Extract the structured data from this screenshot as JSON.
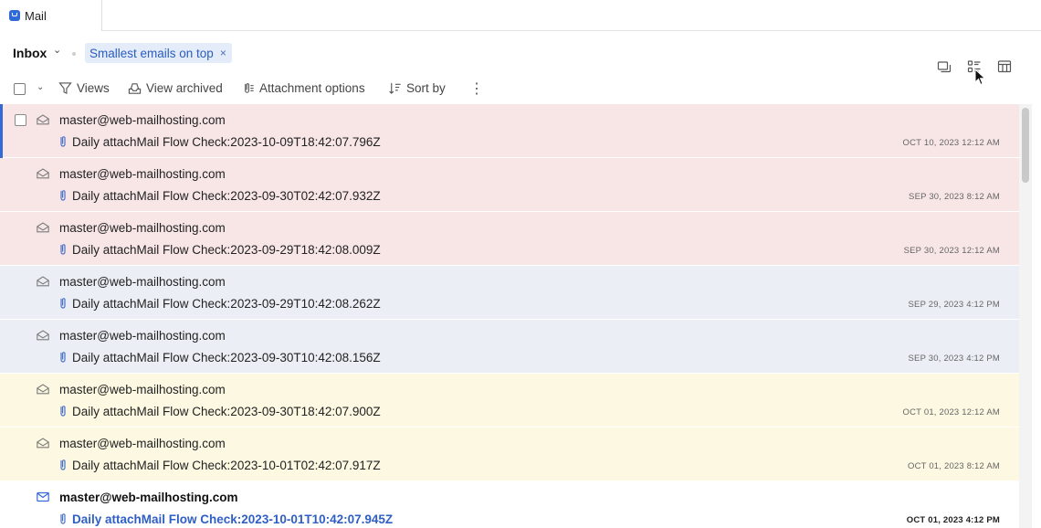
{
  "tab": {
    "label": "Mail"
  },
  "header": {
    "inbox_label": "Inbox",
    "chevron": "⌄",
    "filter_chip": "Smallest emails on top",
    "chip_close": "×"
  },
  "toolbar": {
    "views": "Views",
    "view_archived": "View archived",
    "attachment_options": "Attachment options",
    "sort_by": "Sort by",
    "more": "⋮"
  },
  "colors": {
    "accent": "#3469d6",
    "red_row": "#f8e6e7",
    "blue_row": "#ebeff5",
    "yellow_row": "#fcf8e1",
    "white_row": "#ffffff"
  },
  "emails": [
    {
      "sender": "master@web-mailhosting.com",
      "subject": "Daily attachMail Flow Check:2023-10-09T18:42:07.796Z",
      "date": "OCT 10, 2023 12:12 AM",
      "color": "#f8e6e7",
      "unread": false,
      "active": true
    },
    {
      "sender": "master@web-mailhosting.com",
      "subject": "Daily attachMail Flow Check:2023-09-30T02:42:07.932Z",
      "date": "SEP 30, 2023 8:12 AM",
      "color": "#f8e6e7",
      "unread": false,
      "active": false
    },
    {
      "sender": "master@web-mailhosting.com",
      "subject": "Daily attachMail Flow Check:2023-09-29T18:42:08.009Z",
      "date": "SEP 30, 2023 12:12 AM",
      "color": "#f8e6e7",
      "unread": false,
      "active": false
    },
    {
      "sender": "master@web-mailhosting.com",
      "subject": "Daily attachMail Flow Check:2023-09-29T10:42:08.262Z",
      "date": "SEP 29, 2023 4:12 PM",
      "color": "#ebeff5",
      "unread": false,
      "active": false
    },
    {
      "sender": "master@web-mailhosting.com",
      "subject": "Daily attachMail Flow Check:2023-09-30T10:42:08.156Z",
      "date": "SEP 30, 2023 4:12 PM",
      "color": "#ebeff5",
      "unread": false,
      "active": false
    },
    {
      "sender": "master@web-mailhosting.com",
      "subject": "Daily attachMail Flow Check:2023-09-30T18:42:07.900Z",
      "date": "OCT 01, 2023 12:12 AM",
      "color": "#fcf8e1",
      "unread": false,
      "active": false
    },
    {
      "sender": "master@web-mailhosting.com",
      "subject": "Daily attachMail Flow Check:2023-10-01T02:42:07.917Z",
      "date": "OCT 01, 2023 8:12 AM",
      "color": "#fcf8e1",
      "unread": false,
      "active": false
    },
    {
      "sender": "master@web-mailhosting.com",
      "subject": "Daily attachMail Flow Check:2023-10-01T10:42:07.945Z",
      "date": "OCT 01, 2023 4:12 PM",
      "color": "#ffffff",
      "unread": true,
      "active": false
    }
  ]
}
